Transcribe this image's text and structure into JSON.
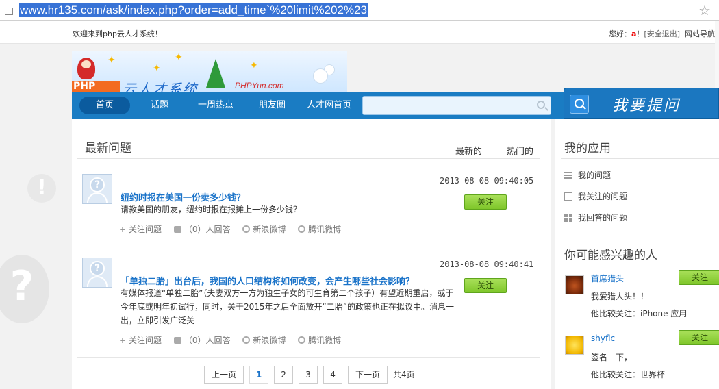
{
  "browser": {
    "url": "www.hr135.com/ask/index.php?order=add_time`%20limit%202%23"
  },
  "topbar": {
    "welcome": "欢迎来到php云人才系统！",
    "greeting": "您好：",
    "username": "a",
    "exclaim": "！",
    "logout": "[安全退出]",
    "site_nav": "网站导航"
  },
  "banner": {
    "logo_text": "PHP",
    "brand": "云人才系统",
    "site": "PHPYun.com"
  },
  "nav": {
    "items": [
      "首页",
      "话题",
      "一周热点",
      "朋友圈",
      "人才网首页"
    ],
    "search_placeholder": "",
    "ask_label": "我要提问"
  },
  "main": {
    "title": "最新问题",
    "tabs": [
      "最新的",
      "热门的"
    ],
    "questions": [
      {
        "time": "2013-08-08 09:40:05",
        "title": "纽约时报在美国一份卖多少钱？",
        "body": "请教美国的朋友，纽约时报在报摊上一份多少钱？",
        "follow_label": "关注"
      },
      {
        "time": "2013-08-08 09:40:41",
        "title": "「单独二胎」出台后，我国的人口结构将如何改变，会产生哪些社会影响？",
        "body": "有媒体报道“单独二胎”（夫妻双方一方为独生子女的可生育第二个孩子）有望近期重启，或于今年底或明年初试行，同时，关于2015年之后全面放开“二胎”的政策也正在拟议中。消息一出，立即引发广泛关",
        "follow_label": "关注"
      }
    ],
    "actions": {
      "follow_question": "关注问题",
      "answers": "（0）人回答",
      "sina_weibo": "新浪微博",
      "tencent_weibo": "腾讯微博"
    },
    "pager": {
      "prev": "上一页",
      "pages": [
        "1",
        "2",
        "3",
        "4"
      ],
      "current": "1",
      "next": "下一页",
      "total": "共4页"
    }
  },
  "sidebar": {
    "apps_title": "我的应用",
    "apps": [
      "我的问题",
      "我关注的问题",
      "我回答的问题"
    ],
    "people_title": "你可能感兴趣的人",
    "people": [
      {
        "name": "首席猎头",
        "bio": "我爱猎人头！！",
        "follows": "他比较关注：iPhone 应用",
        "follow_label": "关注"
      },
      {
        "name": "shyflc",
        "bio": "签名一下，",
        "follows": "他比较关注：世界杯",
        "follow_label": "关注"
      }
    ]
  },
  "colors": {
    "nav_blue": "#1a7cc3",
    "link_blue": "#1a73c9",
    "follow_green": "#8fd03a",
    "username_red": "#e00000"
  }
}
